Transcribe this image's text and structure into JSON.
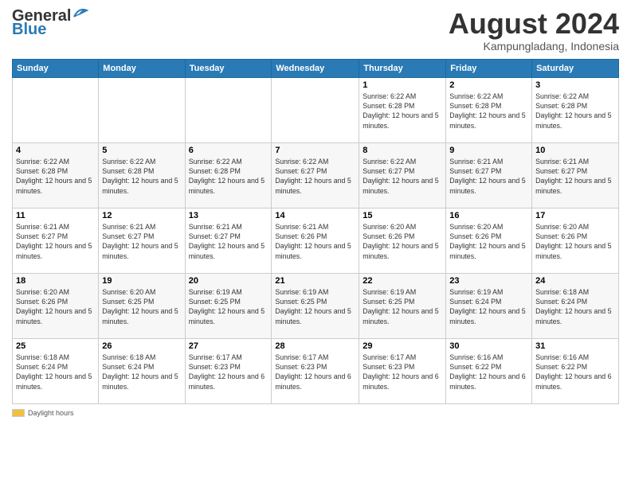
{
  "logo": {
    "line1": "General",
    "line2": "Blue"
  },
  "title": "August 2024",
  "subtitle": "Kampungladang, Indonesia",
  "days_of_week": [
    "Sunday",
    "Monday",
    "Tuesday",
    "Wednesday",
    "Thursday",
    "Friday",
    "Saturday"
  ],
  "weeks": [
    [
      {
        "day": "",
        "info": ""
      },
      {
        "day": "",
        "info": ""
      },
      {
        "day": "",
        "info": ""
      },
      {
        "day": "",
        "info": ""
      },
      {
        "day": "1",
        "info": "Sunrise: 6:22 AM\nSunset: 6:28 PM\nDaylight: 12 hours and 5 minutes."
      },
      {
        "day": "2",
        "info": "Sunrise: 6:22 AM\nSunset: 6:28 PM\nDaylight: 12 hours and 5 minutes."
      },
      {
        "day": "3",
        "info": "Sunrise: 6:22 AM\nSunset: 6:28 PM\nDaylight: 12 hours and 5 minutes."
      }
    ],
    [
      {
        "day": "4",
        "info": "Sunrise: 6:22 AM\nSunset: 6:28 PM\nDaylight: 12 hours and 5 minutes."
      },
      {
        "day": "5",
        "info": "Sunrise: 6:22 AM\nSunset: 6:28 PM\nDaylight: 12 hours and 5 minutes."
      },
      {
        "day": "6",
        "info": "Sunrise: 6:22 AM\nSunset: 6:28 PM\nDaylight: 12 hours and 5 minutes."
      },
      {
        "day": "7",
        "info": "Sunrise: 6:22 AM\nSunset: 6:27 PM\nDaylight: 12 hours and 5 minutes."
      },
      {
        "day": "8",
        "info": "Sunrise: 6:22 AM\nSunset: 6:27 PM\nDaylight: 12 hours and 5 minutes."
      },
      {
        "day": "9",
        "info": "Sunrise: 6:21 AM\nSunset: 6:27 PM\nDaylight: 12 hours and 5 minutes."
      },
      {
        "day": "10",
        "info": "Sunrise: 6:21 AM\nSunset: 6:27 PM\nDaylight: 12 hours and 5 minutes."
      }
    ],
    [
      {
        "day": "11",
        "info": "Sunrise: 6:21 AM\nSunset: 6:27 PM\nDaylight: 12 hours and 5 minutes."
      },
      {
        "day": "12",
        "info": "Sunrise: 6:21 AM\nSunset: 6:27 PM\nDaylight: 12 hours and 5 minutes."
      },
      {
        "day": "13",
        "info": "Sunrise: 6:21 AM\nSunset: 6:27 PM\nDaylight: 12 hours and 5 minutes."
      },
      {
        "day": "14",
        "info": "Sunrise: 6:21 AM\nSunset: 6:26 PM\nDaylight: 12 hours and 5 minutes."
      },
      {
        "day": "15",
        "info": "Sunrise: 6:20 AM\nSunset: 6:26 PM\nDaylight: 12 hours and 5 minutes."
      },
      {
        "day": "16",
        "info": "Sunrise: 6:20 AM\nSunset: 6:26 PM\nDaylight: 12 hours and 5 minutes."
      },
      {
        "day": "17",
        "info": "Sunrise: 6:20 AM\nSunset: 6:26 PM\nDaylight: 12 hours and 5 minutes."
      }
    ],
    [
      {
        "day": "18",
        "info": "Sunrise: 6:20 AM\nSunset: 6:26 PM\nDaylight: 12 hours and 5 minutes."
      },
      {
        "day": "19",
        "info": "Sunrise: 6:20 AM\nSunset: 6:25 PM\nDaylight: 12 hours and 5 minutes."
      },
      {
        "day": "20",
        "info": "Sunrise: 6:19 AM\nSunset: 6:25 PM\nDaylight: 12 hours and 5 minutes."
      },
      {
        "day": "21",
        "info": "Sunrise: 6:19 AM\nSunset: 6:25 PM\nDaylight: 12 hours and 5 minutes."
      },
      {
        "day": "22",
        "info": "Sunrise: 6:19 AM\nSunset: 6:25 PM\nDaylight: 12 hours and 5 minutes."
      },
      {
        "day": "23",
        "info": "Sunrise: 6:19 AM\nSunset: 6:24 PM\nDaylight: 12 hours and 5 minutes."
      },
      {
        "day": "24",
        "info": "Sunrise: 6:18 AM\nSunset: 6:24 PM\nDaylight: 12 hours and 5 minutes."
      }
    ],
    [
      {
        "day": "25",
        "info": "Sunrise: 6:18 AM\nSunset: 6:24 PM\nDaylight: 12 hours and 5 minutes."
      },
      {
        "day": "26",
        "info": "Sunrise: 6:18 AM\nSunset: 6:24 PM\nDaylight: 12 hours and 5 minutes."
      },
      {
        "day": "27",
        "info": "Sunrise: 6:17 AM\nSunset: 6:23 PM\nDaylight: 12 hours and 6 minutes."
      },
      {
        "day": "28",
        "info": "Sunrise: 6:17 AM\nSunset: 6:23 PM\nDaylight: 12 hours and 6 minutes."
      },
      {
        "day": "29",
        "info": "Sunrise: 6:17 AM\nSunset: 6:23 PM\nDaylight: 12 hours and 6 minutes."
      },
      {
        "day": "30",
        "info": "Sunrise: 6:16 AM\nSunset: 6:22 PM\nDaylight: 12 hours and 6 minutes."
      },
      {
        "day": "31",
        "info": "Sunrise: 6:16 AM\nSunset: 6:22 PM\nDaylight: 12 hours and 6 minutes."
      }
    ]
  ],
  "footer": {
    "daylight_label": "Daylight hours"
  }
}
